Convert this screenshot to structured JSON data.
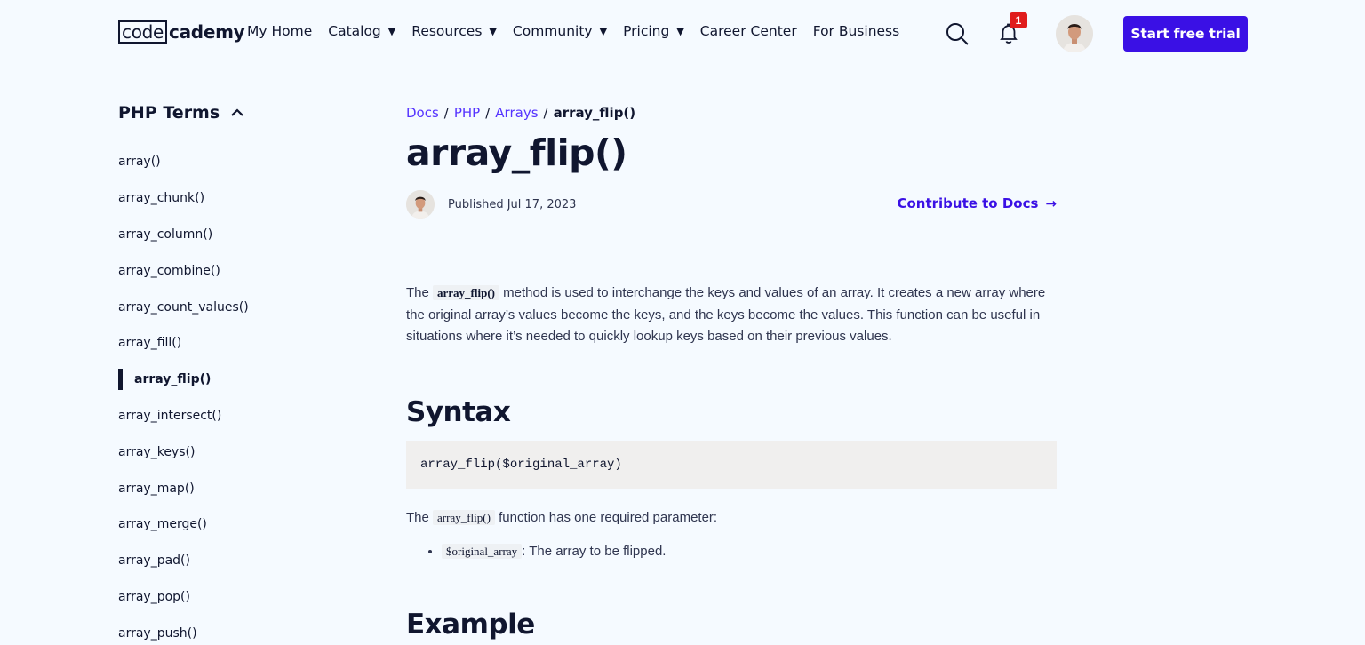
{
  "header": {
    "logo": {
      "box": "code",
      "rest": "cademy"
    },
    "nav": [
      {
        "label": "My Home",
        "dropdown": false
      },
      {
        "label": "Catalog",
        "dropdown": true
      },
      {
        "label": "Resources",
        "dropdown": true
      },
      {
        "label": "Community",
        "dropdown": true
      },
      {
        "label": "Pricing",
        "dropdown": true
      },
      {
        "label": "Career Center",
        "dropdown": false
      },
      {
        "label": "For Business",
        "dropdown": false
      }
    ],
    "caret": "▼",
    "notification_count": "1",
    "cta_label": "Start free trial",
    "accent_color": "#3a10e5",
    "badge_color": "#e01c1c"
  },
  "sidebar": {
    "title": "PHP Terms",
    "items": [
      {
        "label": "array()"
      },
      {
        "label": "array_chunk()"
      },
      {
        "label": "array_column()"
      },
      {
        "label": "array_combine()"
      },
      {
        "label": "array_count_values()"
      },
      {
        "label": "array_fill()"
      },
      {
        "label": "array_flip()",
        "active": true
      },
      {
        "label": "array_intersect()"
      },
      {
        "label": "array_keys()"
      },
      {
        "label": "array_map()"
      },
      {
        "label": "array_merge()"
      },
      {
        "label": "array_pad()"
      },
      {
        "label": "array_pop()"
      },
      {
        "label": "array_push()"
      }
    ]
  },
  "main": {
    "breadcrumb": {
      "links": [
        "Docs",
        "PHP",
        "Arrays"
      ],
      "separator": "/",
      "current": "array_flip()"
    },
    "title": "array_flip()",
    "published": "Published Jul 17, 2023",
    "contribute_label": "Contribute to Docs",
    "contribute_arrow": "→",
    "intro": {
      "before": "The ",
      "code": "array_flip()",
      "after": " method is used to interchange the keys and values of an array. It creates a new array where the original array’s values become the keys, and the keys become the values. This function can be useful in situations where it’s needed to quickly lookup keys based on their previous values."
    },
    "syntax_heading": "Syntax",
    "syntax_code": "array_flip($original_array)",
    "param_intro": {
      "before": "The ",
      "code": "array_flip()",
      "after": " function has one required parameter:"
    },
    "params": [
      {
        "code": "$original_array",
        "desc": ": The array to be flipped."
      }
    ],
    "example_heading": "Example"
  }
}
